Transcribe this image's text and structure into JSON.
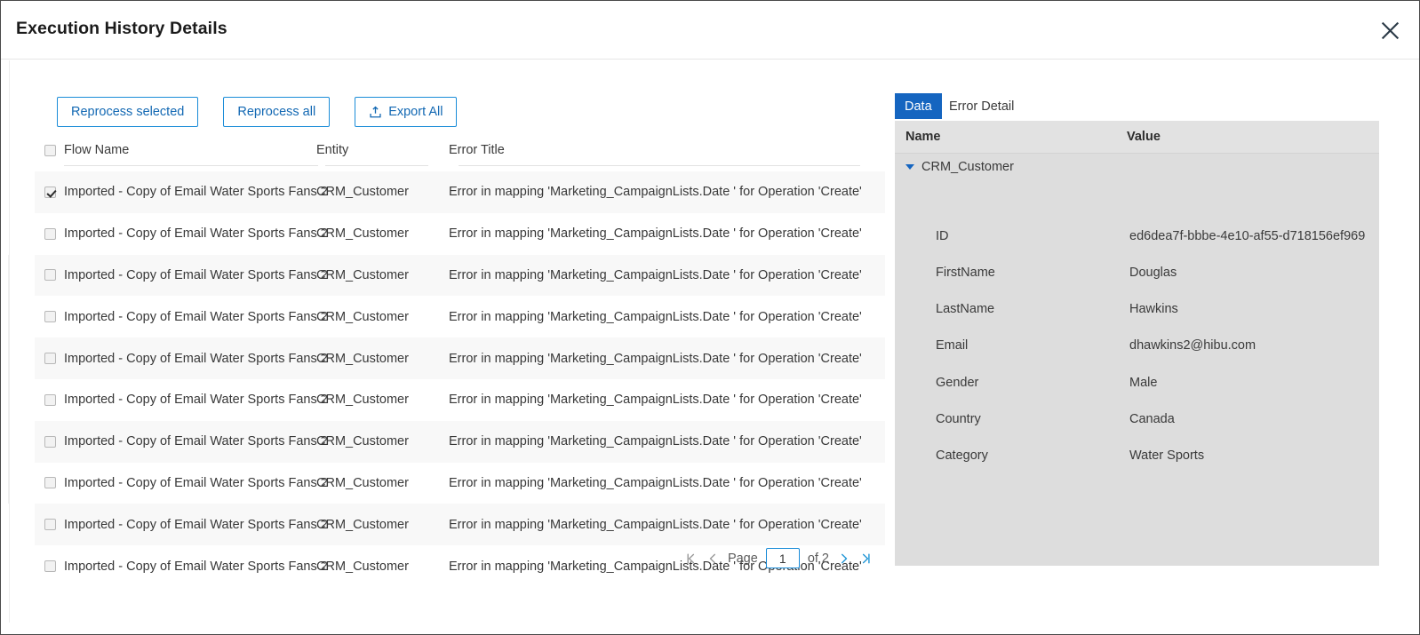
{
  "dialog": {
    "title": "Execution History Details",
    "close_icon": "close-icon"
  },
  "toolbar": {
    "reprocess_selected_label": "Reprocess selected",
    "reprocess_all_label": "Reprocess all",
    "export_all_label": "Export All",
    "export_icon": "export-icon",
    "accent_color": "#1a8cd8",
    "link_color": "#1268b3"
  },
  "table": {
    "columns": [
      "Flow Name",
      "Entity",
      "Error Title"
    ],
    "header_checkbox_checked": false,
    "rows": [
      {
        "checked": true,
        "flow": "Imported - Copy of Email Water Sports Fans 2",
        "entity": "CRM_Customer",
        "error": "Error in mapping 'Marketing_CampaignLists.Date ' for Operation 'Create'"
      },
      {
        "checked": false,
        "flow": "Imported - Copy of Email Water Sports Fans 2",
        "entity": "CRM_Customer",
        "error": "Error in mapping 'Marketing_CampaignLists.Date ' for Operation 'Create'"
      },
      {
        "checked": false,
        "flow": "Imported - Copy of Email Water Sports Fans 2",
        "entity": "CRM_Customer",
        "error": "Error in mapping 'Marketing_CampaignLists.Date ' for Operation 'Create'"
      },
      {
        "checked": false,
        "flow": "Imported - Copy of Email Water Sports Fans 2",
        "entity": "CRM_Customer",
        "error": "Error in mapping 'Marketing_CampaignLists.Date ' for Operation 'Create'"
      },
      {
        "checked": false,
        "flow": "Imported - Copy of Email Water Sports Fans 2",
        "entity": "CRM_Customer",
        "error": "Error in mapping 'Marketing_CampaignLists.Date ' for Operation 'Create'"
      },
      {
        "checked": false,
        "flow": "Imported - Copy of Email Water Sports Fans 2",
        "entity": "CRM_Customer",
        "error": "Error in mapping 'Marketing_CampaignLists.Date ' for Operation 'Create'"
      },
      {
        "checked": false,
        "flow": "Imported - Copy of Email Water Sports Fans 2",
        "entity": "CRM_Customer",
        "error": "Error in mapping 'Marketing_CampaignLists.Date ' for Operation 'Create'"
      },
      {
        "checked": false,
        "flow": "Imported - Copy of Email Water Sports Fans 2",
        "entity": "CRM_Customer",
        "error": "Error in mapping 'Marketing_CampaignLists.Date ' for Operation 'Create'"
      },
      {
        "checked": false,
        "flow": "Imported - Copy of Email Water Sports Fans 2",
        "entity": "CRM_Customer",
        "error": "Error in mapping 'Marketing_CampaignLists.Date ' for Operation 'Create'"
      },
      {
        "checked": false,
        "flow": "Imported - Copy of Email Water Sports Fans 2",
        "entity": "CRM_Customer",
        "error": "Error in mapping 'Marketing_CampaignLists.Date ' for Operation 'Create'"
      }
    ]
  },
  "pagination": {
    "first_icon": "first-page-icon",
    "prev_icon": "previous-page-icon",
    "page_label": "Page",
    "page_value": "1",
    "of_label": "of 2",
    "next_icon": "next-page-icon",
    "last_icon": "last-page-icon"
  },
  "detail": {
    "tabs": [
      {
        "label": "Data",
        "active": true
      },
      {
        "label": "Error Detail",
        "active": false
      }
    ],
    "columns": [
      "Name",
      "Value"
    ],
    "root_node": "CRM_Customer",
    "root_expanded": true,
    "fields": [
      {
        "name": "ID",
        "value": "ed6dea7f-bbbe-4e10-af55-d718156ef969"
      },
      {
        "name": "FirstName",
        "value": "Douglas"
      },
      {
        "name": "LastName",
        "value": "Hawkins"
      },
      {
        "name": "Email",
        "value": "dhawkins2@hibu.com"
      },
      {
        "name": "Gender",
        "value": "Male"
      },
      {
        "name": "Country",
        "value": "Canada"
      },
      {
        "name": "Category",
        "value": "Water Sports"
      }
    ]
  }
}
